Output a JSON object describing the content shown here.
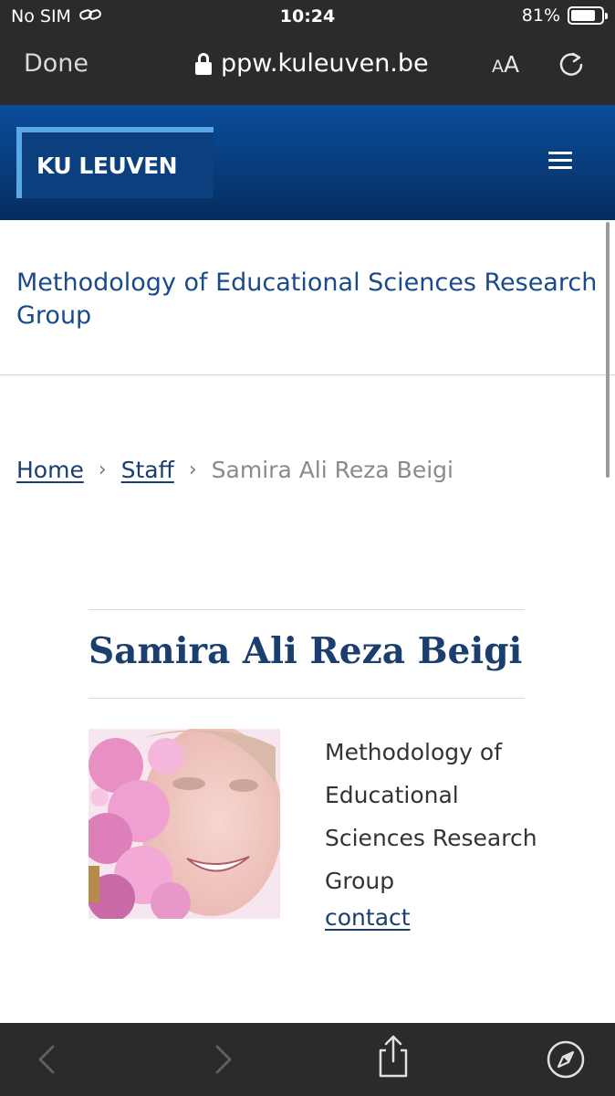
{
  "status_bar": {
    "carrier": "No SIM",
    "time": "10:24",
    "battery_percent": "81%",
    "battery_level": 0.81
  },
  "browser": {
    "done_label": "Done",
    "url": "ppw.kuleuven.be",
    "text_size_small": "A",
    "text_size_big": "A"
  },
  "header": {
    "logo_text": "KU LEUVEN",
    "brand_color": "#0b3f7d"
  },
  "group_title": "Methodology of Educational Sciences Research Group",
  "breadcrumb": {
    "items": [
      "Home",
      "Staff"
    ],
    "separator": "›",
    "current": "Samira Ali Reza Beigi"
  },
  "person": {
    "name": "Samira Ali Reza Beigi",
    "affiliation": "Methodology of Educational Sciences Research Group",
    "contact_label": "contact"
  }
}
